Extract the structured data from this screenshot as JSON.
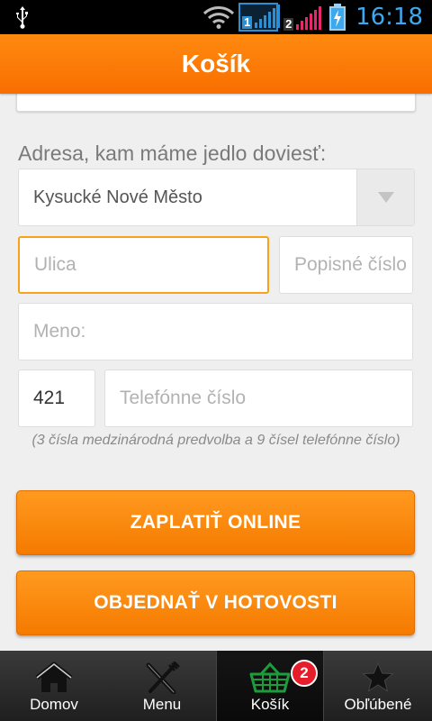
{
  "status_bar": {
    "time": "16:18",
    "sim1_number": "1",
    "sim2_number": "2",
    "icons": [
      "usb-icon",
      "wifi-icon",
      "signal-sim1-icon",
      "signal-sim2-icon",
      "battery-charging-icon"
    ],
    "colors": {
      "time": "#3ea8ef",
      "sim1": "#2b8fd6",
      "sim2_bars": "#e6296f"
    }
  },
  "header": {
    "title": "Košík",
    "color": "#f97a05"
  },
  "form": {
    "section_label": "Adresa, kam máme jedlo doviesť:",
    "city_select": {
      "value": "Kysucké Nové Město",
      "icon": "chevron-down-icon"
    },
    "street": {
      "placeholder": "Ulica",
      "value": ""
    },
    "house_number": {
      "placeholder": "Popisné číslo",
      "value": ""
    },
    "name": {
      "placeholder": "Meno:",
      "value": ""
    },
    "phone_prefix": {
      "value": "421"
    },
    "phone_number": {
      "placeholder": "Telefónne číslo",
      "value": ""
    },
    "helper_text": "(3 čísla medzinárodná predvolba a 9 čísel telefónne číslo)"
  },
  "actions": {
    "pay_online_label": "ZAPLATIŤ ONLINE",
    "cash_order_label": "OBJEDNAŤ V HOTOVOSTI",
    "accent_color": "#f8860e"
  },
  "bottom_nav": {
    "items": [
      {
        "label": "Domov",
        "icon": "home-icon"
      },
      {
        "label": "Menu",
        "icon": "fork-knife-icon"
      },
      {
        "label": "Košík",
        "icon": "basket-icon",
        "badge": "2",
        "active": true
      },
      {
        "label": "Obľúbené",
        "icon": "star-icon"
      }
    ]
  }
}
